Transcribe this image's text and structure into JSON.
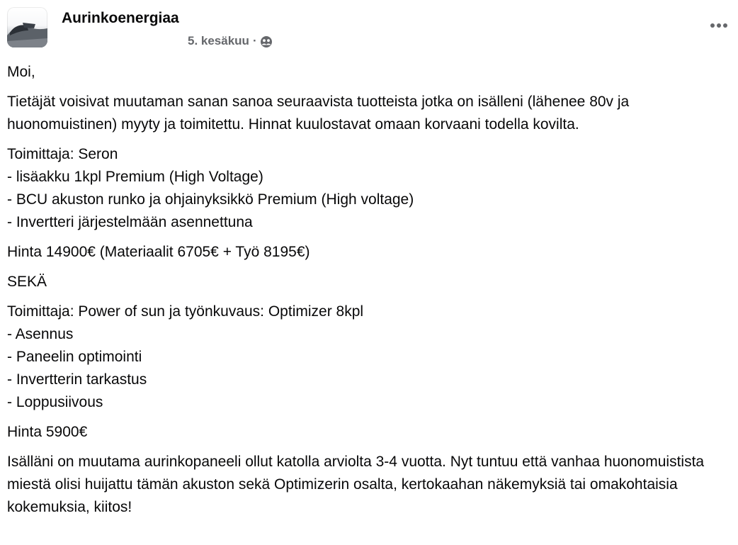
{
  "post": {
    "author": "Aurinkoenergiaa",
    "date": "5. kesäkuu",
    "separator": "·",
    "audience_icon": "group-audience-icon",
    "more_icon": "more-options-icon",
    "paragraphs": [
      "Moi,",
      "Tietäjät voisivat muutaman sanan sanoa seuraavista tuotteista jotka on isälleni (lähenee 80v ja huonomuistinen) myyty ja toimitettu. Hinnat kuulostavat omaan korvaani todella kovilta.",
      "Toimittaja: Seron\n- lisäakku 1kpl Premium (High Voltage)\n- BCU akuston runko ja ohjainyksikkö Premium (High voltage)\n- Invertteri järjestelmään asennettuna",
      "Hinta 14900€ (Materiaalit 6705€ + Työ 8195€)",
      "SEKÄ",
      "Toimittaja: Power of sun ja työnkuvaus: Optimizer 8kpl\n- Asennus\n- Paneelin optimointi\n- Invertterin tarkastus\n- Loppusiivous",
      "Hinta 5900€",
      "Isälläni on muutama aurinkopaneeli ollut katolla arviolta 3-4 vuotta. Nyt tuntuu että vanhaa huonomuistista miestä olisi huijattu tämän akuston sekä Optimizerin osalta, kertokaahan näkemyksiä tai omakohtaisia kokemuksia, kiitos!"
    ]
  },
  "colors": {
    "text": "#080809",
    "meta": "#65676b",
    "background": "#ffffff"
  }
}
